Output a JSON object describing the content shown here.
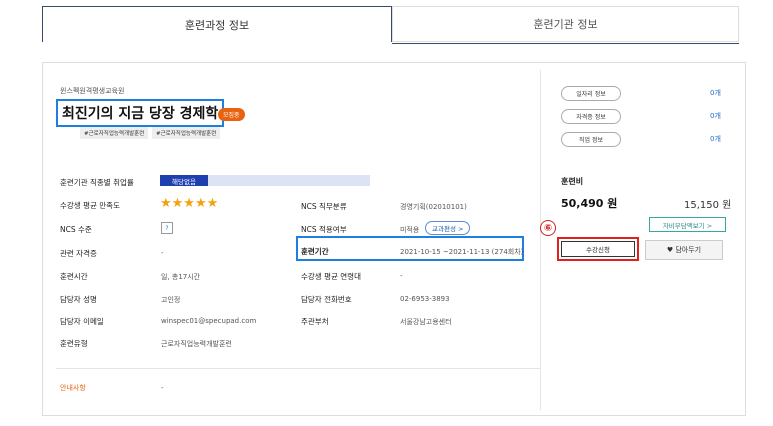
{
  "tabs": [
    "훈련과정 정보",
    "훈련기관 정보"
  ],
  "institution": "윈스펙원격평생교육원",
  "course_title": "최진기의 지금 당장 경제학",
  "status_badge": "모집중",
  "tags": [
    "#근로자직업능력개발훈련",
    "#근로자직업능력개발훈련"
  ],
  "side_info": [
    {
      "label": "일자리 정보",
      "count": "0개"
    },
    {
      "label": "자격증 정보",
      "count": "0개"
    },
    {
      "label": "직업 정보",
      "count": "0개"
    }
  ],
  "employment_rate": {
    "label": "훈련기관 직종별 취업률",
    "value": "해당없음"
  },
  "satisfaction": {
    "label": "수강생 평균 만족도",
    "stars": "★★★★★"
  },
  "ncs_level": {
    "label": "NCS 수준",
    "value": "?"
  },
  "cert": {
    "label": "관련 자격증",
    "value": "-"
  },
  "hours": {
    "label": "훈련시간",
    "value": "일, 총17시간"
  },
  "manager": {
    "label": "담당자 성명",
    "value": "고인정"
  },
  "email": {
    "label": "담당자 이메일",
    "value": "winspec01@specupad.com"
  },
  "training_type": {
    "label": "훈련유형",
    "value": "근로자직업능력개발훈련"
  },
  "ncs_class": {
    "label": "NCS 직무분류",
    "value": "경영기획(02010101)"
  },
  "ncs_apply": {
    "label": "NCS 적용여부",
    "value": "미적용",
    "pill": "교과편성 >"
  },
  "period": {
    "label": "훈련기간",
    "value": "2021-10-15 ~2021-11-13 (274회차)"
  },
  "age": {
    "label": "수강생 평균 연령대",
    "value": "-"
  },
  "phone": {
    "label": "담당자 전화번호",
    "value": "02-6953-3893"
  },
  "dept": {
    "label": "주관부처",
    "value": "서울강남고용센터"
  },
  "notice": {
    "label": "안내사항",
    "value": "-"
  },
  "fee": {
    "label": "훈련비",
    "amount": "50,490 원",
    "other": "15,150 원",
    "self_button": "자비부담액보기 >"
  },
  "annotation_number": "⑥",
  "apply_button": "수강신청",
  "save_button": "♥ 담아두기"
}
